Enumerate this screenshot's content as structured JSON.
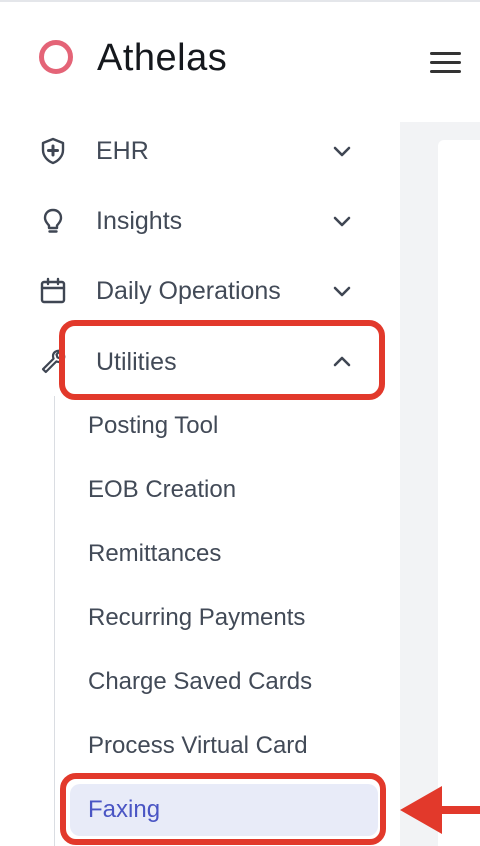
{
  "header": {
    "brand": "Athelas",
    "brand_color": "#e46477",
    "menu_icon": "hamburger-menu-icon"
  },
  "sidebar": {
    "items": [
      {
        "label": "EHR",
        "icon": "shield-plus-icon",
        "expanded": false
      },
      {
        "label": "Insights",
        "icon": "lightbulb-icon",
        "expanded": false
      },
      {
        "label": "Daily Operations",
        "icon": "calendar-icon",
        "expanded": false
      },
      {
        "label": "Utilities",
        "icon": "wrench-icon",
        "expanded": true
      }
    ],
    "utilities_children": [
      {
        "label": "Posting Tool"
      },
      {
        "label": "EOB Creation"
      },
      {
        "label": "Remittances"
      },
      {
        "label": "Recurring Payments"
      },
      {
        "label": "Charge Saved Cards"
      },
      {
        "label": "Process Virtual Card"
      },
      {
        "label": "Faxing",
        "active": true
      }
    ]
  },
  "colors": {
    "annotation_red": "#e2392b",
    "active_text": "#4a55c4",
    "active_bg": "#e8ebf8"
  }
}
